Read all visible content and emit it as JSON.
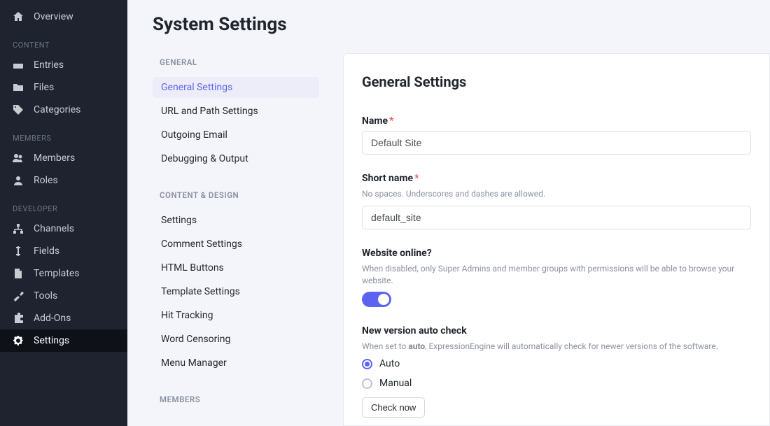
{
  "sidebar": {
    "overview": "Overview",
    "sections": {
      "content": "CONTENT",
      "members": "MEMBERS",
      "developer": "DEVELOPER"
    },
    "items": {
      "entries": "Entries",
      "files": "Files",
      "categories": "Categories",
      "members": "Members",
      "roles": "Roles",
      "channels": "Channels",
      "fields": "Fields",
      "templates": "Templates",
      "tools": "Tools",
      "addons": "Add-Ons",
      "settings": "Settings"
    }
  },
  "pageTitle": "System Settings",
  "subnav": {
    "groups": {
      "general": "GENERAL",
      "content": "CONTENT & DESIGN",
      "members": "MEMBERS"
    },
    "links": {
      "general_settings": "General Settings",
      "url_path": "URL and Path Settings",
      "outgoing_email": "Outgoing Email",
      "debugging": "Debugging & Output",
      "settings": "Settings",
      "comment_settings": "Comment Settings",
      "html_buttons": "HTML Buttons",
      "template_settings": "Template Settings",
      "hit_tracking": "Hit Tracking",
      "word_censoring": "Word Censoring",
      "menu_manager": "Menu Manager"
    }
  },
  "panel": {
    "title": "General Settings",
    "name": {
      "label": "Name",
      "value": "Default Site"
    },
    "short_name": {
      "label": "Short name",
      "hint": "No spaces. Underscores and dashes are allowed.",
      "value": "default_site"
    },
    "online": {
      "label": "Website online?",
      "hint": "When disabled, only Super Admins and member groups with permissions will be able to browse your website."
    },
    "version": {
      "label": "New version auto check",
      "hint_pre": "When set to ",
      "hint_strong": "auto",
      "hint_post": ", ExpressionEngine will automatically check for newer versions of the software.",
      "opt_auto": "Auto",
      "opt_manual": "Manual",
      "check_btn": "Check now"
    }
  }
}
